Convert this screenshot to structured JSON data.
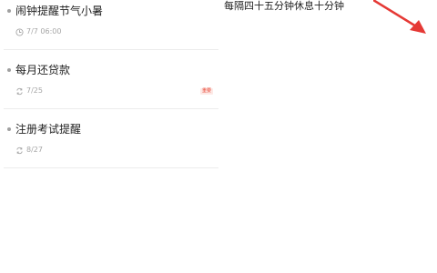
{
  "reminders": [
    {
      "title": "闹钟提醒节气小暑",
      "meta": "7/7 06:00",
      "meta_icon": "clock-icon"
    },
    {
      "title": "每月还贷款",
      "meta": "7/25",
      "meta_icon": "repeat-icon",
      "badge": "重要"
    },
    {
      "title": "注册考试提醒",
      "meta": "8/27",
      "meta_icon": "repeat-icon"
    }
  ],
  "detail": {
    "title": "每隔四十五分钟休息十分钟"
  },
  "colors": {
    "text_primary": "#222222",
    "text_secondary": "#a6a6a6",
    "badge_red": "#e8412f",
    "annotation_arrow": "#e53935"
  }
}
